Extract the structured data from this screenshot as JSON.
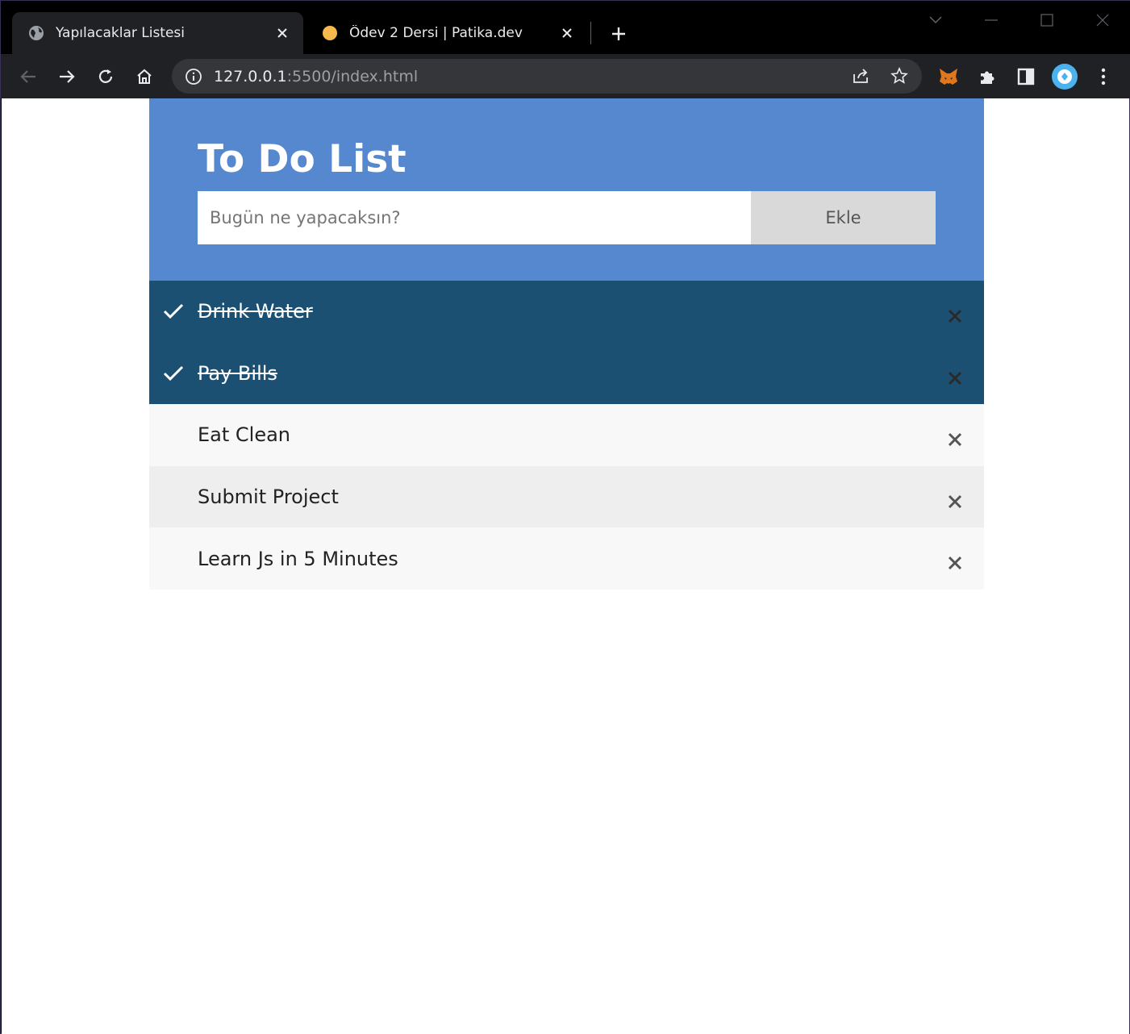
{
  "browser": {
    "tabs": [
      {
        "title": "Yapılacaklar Listesi",
        "active": true,
        "favicon": "globe-icon"
      },
      {
        "title": "Ödev 2 Dersi | Patika.dev",
        "active": false,
        "favicon": "orange-dot-icon"
      }
    ],
    "address": {
      "host": "127.0.0.1",
      "rest": ":5500/index.html"
    },
    "accent": "#5588cf"
  },
  "app": {
    "title": "To Do List",
    "input_placeholder": "Bugün ne yapacaksın?",
    "input_value": "",
    "add_button_label": "Ekle",
    "colors": {
      "header": "#5588cf",
      "checked_row": "#1b5073",
      "row_light": "#f8f8f8",
      "row_alt": "#eeeeee",
      "button": "#d9d9d9"
    },
    "tasks": [
      {
        "label": "Drink Water",
        "checked": true
      },
      {
        "label": "Pay Bills",
        "checked": true
      },
      {
        "label": "Eat Clean",
        "checked": false
      },
      {
        "label": "Submit Project",
        "checked": false
      },
      {
        "label": "Learn Js in 5 Minutes",
        "checked": false
      }
    ]
  }
}
